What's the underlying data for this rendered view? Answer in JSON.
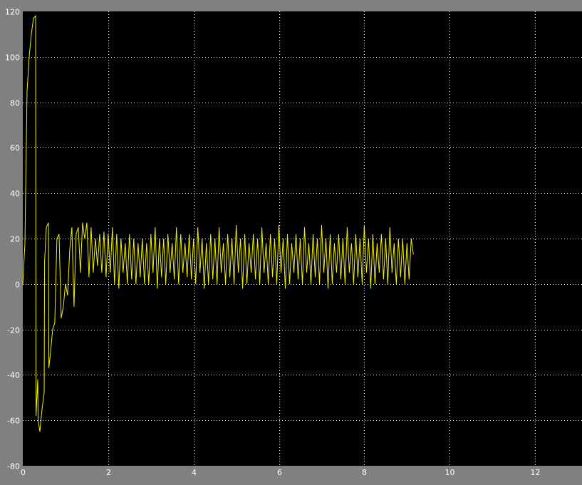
{
  "colors": {
    "frame": "#808080",
    "plot_bg": "#000000",
    "grid": "#ffffff",
    "axis_text": "#ffffff",
    "trace": "#f2f200"
  },
  "chart_data": {
    "type": "line",
    "title": "",
    "xlabel": "",
    "ylabel": "",
    "xlim": [
      0,
      13.1
    ],
    "ylim": [
      -80,
      120
    ],
    "xticks": [
      0,
      2,
      4,
      6,
      8,
      10,
      12
    ],
    "yticks": [
      -80,
      -60,
      -40,
      -20,
      0,
      20,
      40,
      60,
      80,
      100,
      120
    ],
    "xtick_labels": [
      "0",
      "2",
      "4",
      "6",
      "8",
      "10",
      "12"
    ],
    "ytick_labels": [
      "-80",
      "-60",
      "-40",
      "-20",
      "0",
      "20",
      "40",
      "60",
      "80",
      "100",
      "120"
    ],
    "grid": true,
    "legend": "none",
    "series": [
      {
        "x": [
          0,
          0.05,
          0.1,
          0.15,
          0.2,
          0.25,
          0.3,
          0.31,
          0.35,
          0.36,
          0.4,
          0.45,
          0.5,
          0.51,
          0.55,
          0.6,
          0.61,
          0.65,
          0.7,
          0.75,
          0.8,
          0.85,
          0.9,
          0.95,
          1.0,
          1.05,
          1.1,
          1.15,
          1.2,
          1.25,
          1.3,
          1.35,
          1.4,
          1.45,
          1.5,
          1.55,
          1.6,
          1.65,
          1.7,
          1.75,
          1.8,
          1.85,
          1.9,
          1.95,
          2.0,
          2.05,
          2.1,
          2.15,
          2.2,
          2.25,
          2.3,
          2.35,
          2.4,
          2.45,
          2.5,
          2.55,
          2.6,
          2.65,
          2.7,
          2.75,
          2.8,
          2.85,
          2.9,
          2.95,
          3.0,
          3.05,
          3.1,
          3.15,
          3.2,
          3.25,
          3.3,
          3.35,
          3.4,
          3.45,
          3.5,
          3.55,
          3.6,
          3.65,
          3.7,
          3.75,
          3.8,
          3.85,
          3.9,
          3.95,
          4.0,
          4.05,
          4.1,
          4.15,
          4.2,
          4.25,
          4.3,
          4.35,
          4.4,
          4.45,
          4.5,
          4.55,
          4.6,
          4.65,
          4.7,
          4.75,
          4.8,
          4.85,
          4.9,
          4.95,
          5.0,
          5.05,
          5.1,
          5.15,
          5.2,
          5.25,
          5.3,
          5.35,
          5.4,
          5.45,
          5.5,
          5.55,
          5.6,
          5.65,
          5.7,
          5.75,
          5.8,
          5.85,
          5.9,
          5.95,
          6.0,
          6.05,
          6.1,
          6.15,
          6.2,
          6.25,
          6.3,
          6.35,
          6.4,
          6.45,
          6.5,
          6.55,
          6.6,
          6.65,
          6.7,
          6.75,
          6.8,
          6.85,
          6.9,
          6.95,
          7.0,
          7.05,
          7.1,
          7.15,
          7.2,
          7.25,
          7.3,
          7.35,
          7.4,
          7.45,
          7.5,
          7.55,
          7.6,
          7.65,
          7.7,
          7.75,
          7.8,
          7.85,
          7.9,
          7.95,
          8.0,
          8.05,
          8.1,
          8.15,
          8.2,
          8.25,
          8.3,
          8.35,
          8.4,
          8.45,
          8.5,
          8.55,
          8.6,
          8.65,
          8.7,
          8.75,
          8.8,
          8.85,
          8.9,
          8.95,
          9.0,
          9.05,
          9.1,
          9.15
        ],
        "y": [
          0,
          18,
          85,
          100,
          110,
          117,
          118,
          -58,
          -42,
          -60,
          -65,
          -55,
          -48,
          10,
          25,
          27,
          -37,
          -30,
          -20,
          -17,
          20,
          22,
          -15,
          -10,
          0,
          -5,
          15,
          25,
          -10,
          22,
          25,
          5,
          27,
          20,
          27,
          3,
          25,
          5,
          20,
          8,
          22,
          5,
          23,
          3,
          22,
          5,
          25,
          0,
          22,
          -2,
          20,
          5,
          18,
          0,
          22,
          2,
          20,
          0,
          18,
          3,
          20,
          0,
          18,
          0,
          22,
          5,
          25,
          -2,
          20,
          3,
          20,
          0,
          22,
          5,
          18,
          2,
          25,
          0,
          22,
          5,
          18,
          3,
          22,
          2,
          20,
          0,
          25,
          5,
          20,
          -2,
          18,
          0,
          22,
          2,
          20,
          0,
          25,
          5,
          18,
          0,
          22,
          3,
          20,
          0,
          26,
          5,
          20,
          -2,
          22,
          0,
          18,
          5,
          22,
          2,
          20,
          0,
          25,
          5,
          18,
          0,
          22,
          3,
          20,
          0,
          26,
          5,
          20,
          -2,
          22,
          0,
          18,
          5,
          22,
          2,
          20,
          0,
          25,
          5,
          18,
          0,
          22,
          3,
          20,
          0,
          26,
          5,
          20,
          -2,
          22,
          0,
          18,
          5,
          22,
          2,
          20,
          0,
          25,
          5,
          18,
          0,
          22,
          3,
          20,
          0,
          26,
          5,
          20,
          -2,
          22,
          0,
          18,
          5,
          22,
          2,
          20,
          0,
          25,
          5,
          18,
          0,
          20,
          3,
          20,
          0,
          18,
          2,
          20,
          13
        ]
      }
    ]
  }
}
